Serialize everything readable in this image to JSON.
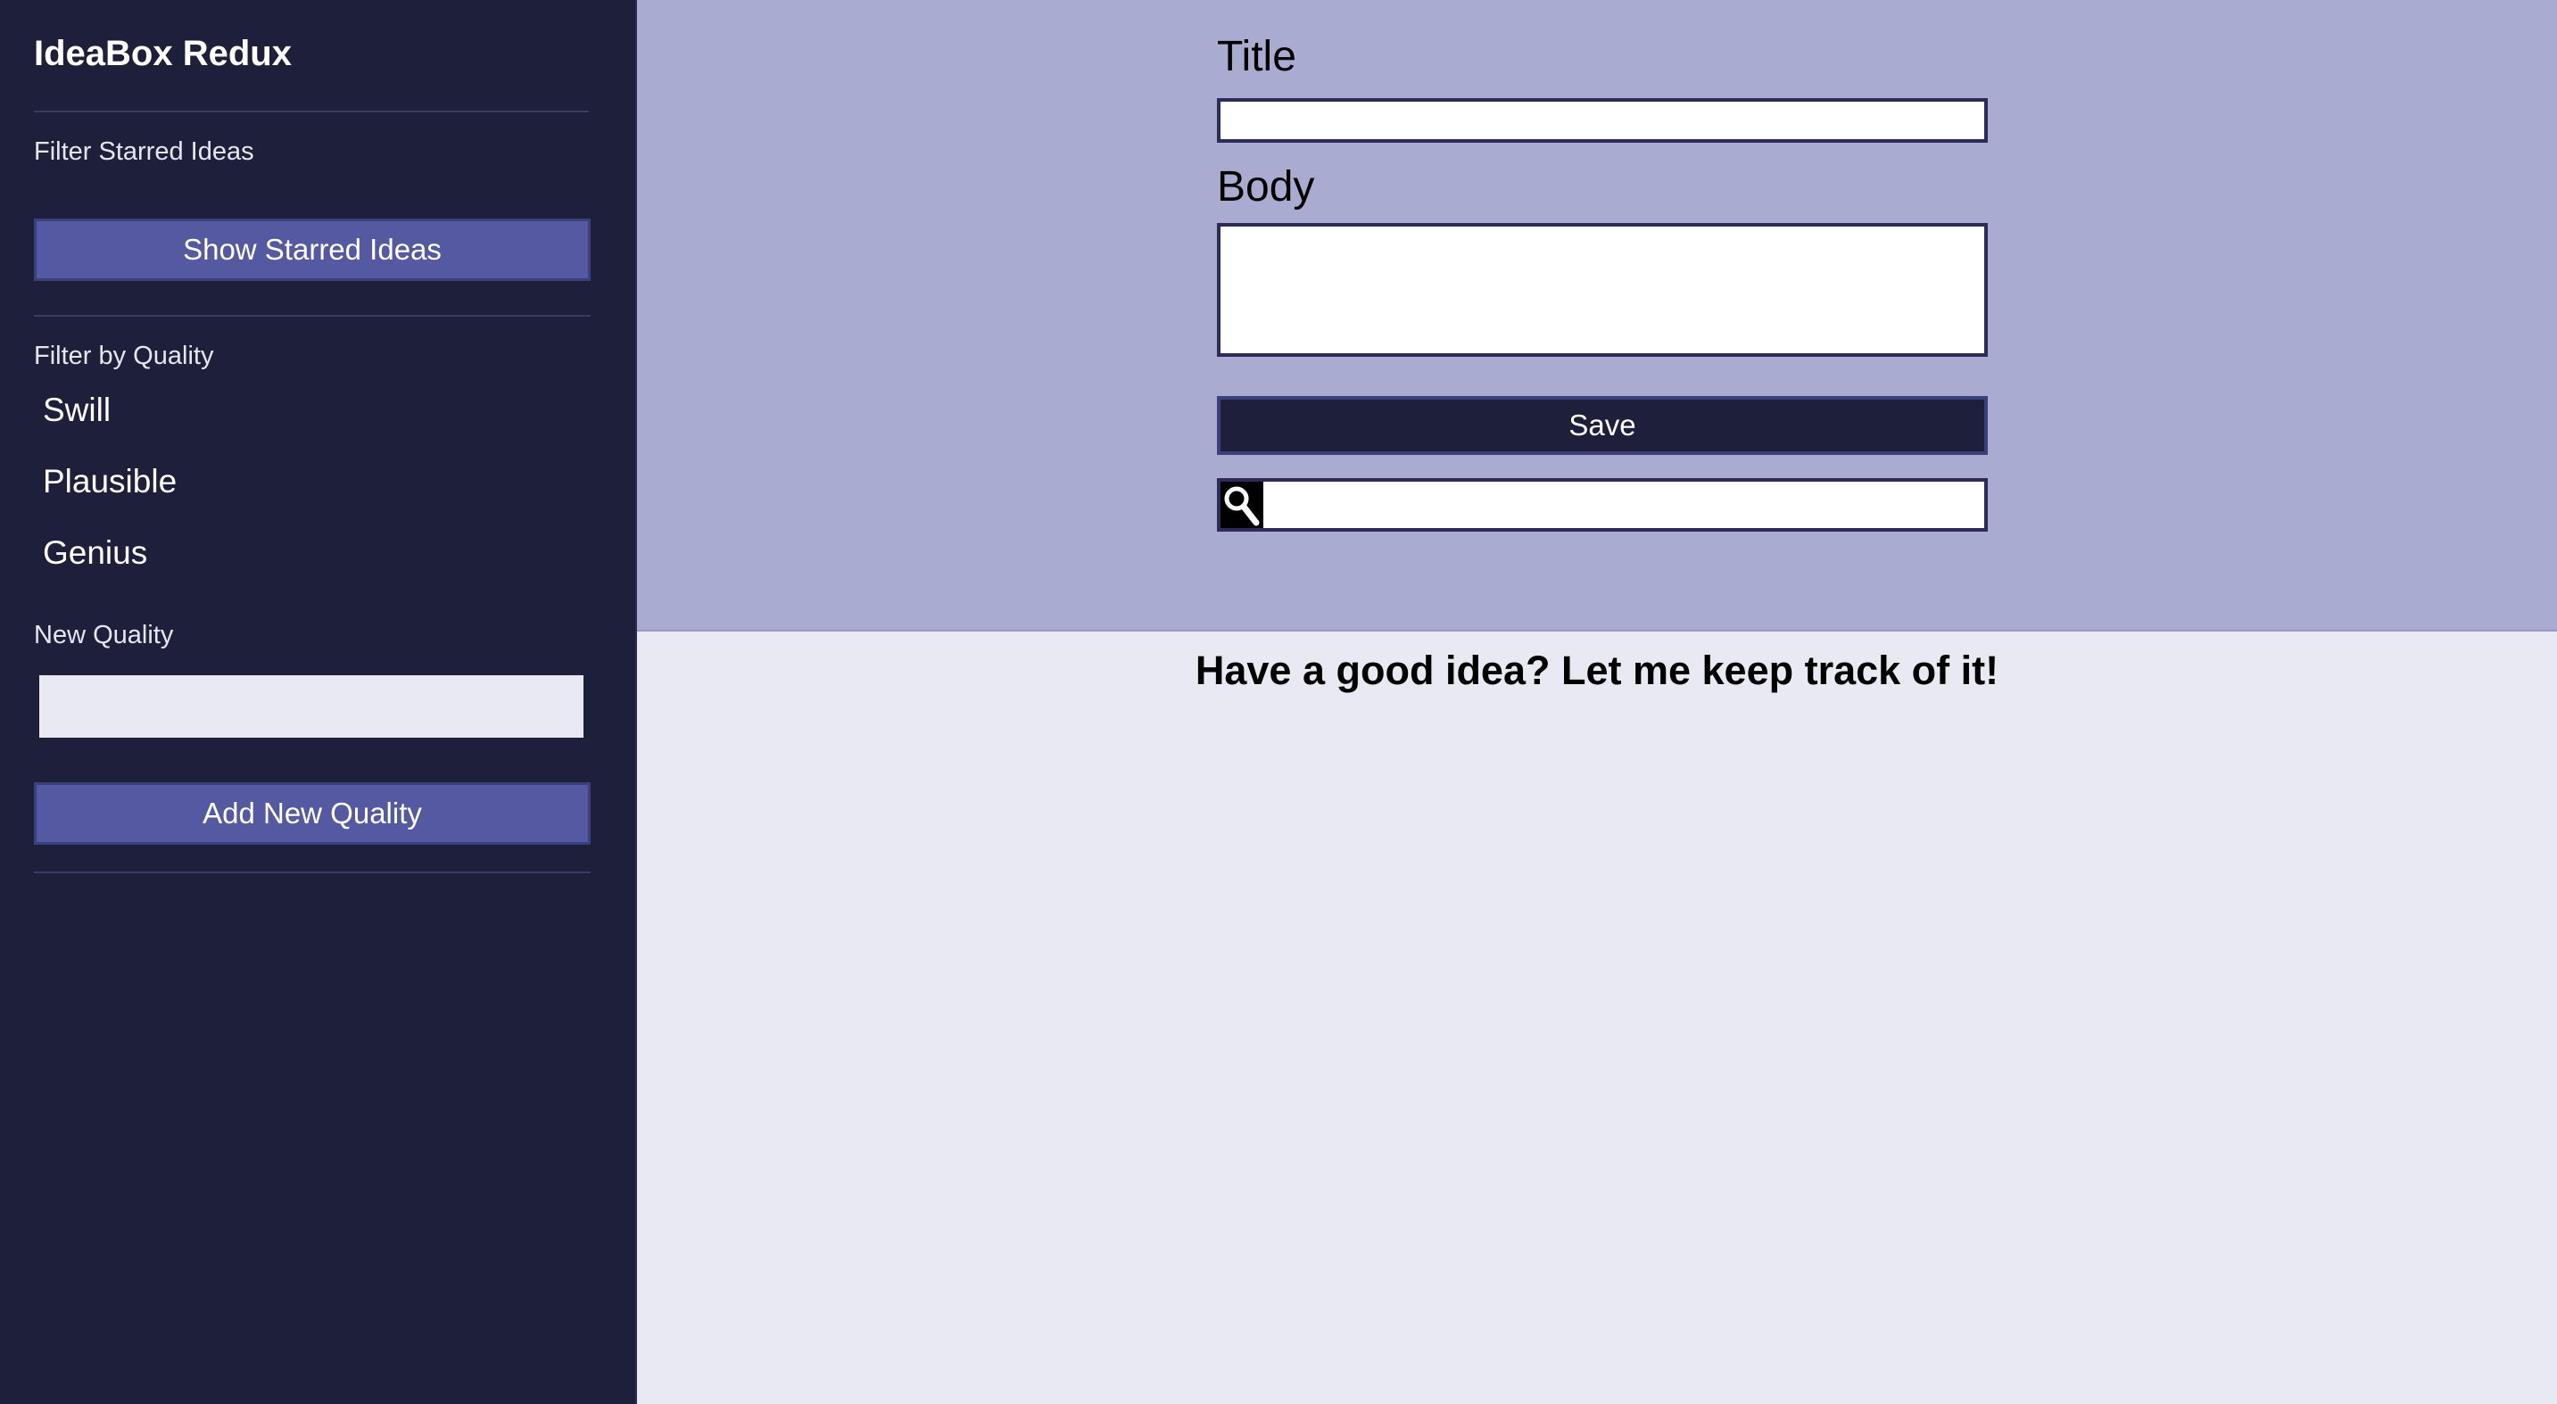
{
  "sidebar": {
    "app_title": "IdeaBox Redux",
    "starred_section_label": "Filter Starred Ideas",
    "show_starred_button": "Show Starred Ideas",
    "quality_section_label": "Filter by Quality",
    "qualities": [
      {
        "label": "Swill"
      },
      {
        "label": "Plausible"
      },
      {
        "label": "Genius"
      }
    ],
    "new_quality_label": "New Quality",
    "new_quality_value": "",
    "add_quality_button": "Add New Quality"
  },
  "form": {
    "title_label": "Title",
    "title_value": "",
    "body_label": "Body",
    "body_value": "",
    "save_button": "Save",
    "search_value": ""
  },
  "main": {
    "tagline": "Have a good idea? Let me keep track of it!"
  },
  "colors": {
    "sidebar_bg": "#1e1f3b",
    "form_bg": "#a9abd1",
    "main_bg": "#e9e9f3",
    "accent_button": "#5459a2",
    "save_button": "#1e1f3b"
  },
  "icons": {
    "search": "search-icon"
  }
}
